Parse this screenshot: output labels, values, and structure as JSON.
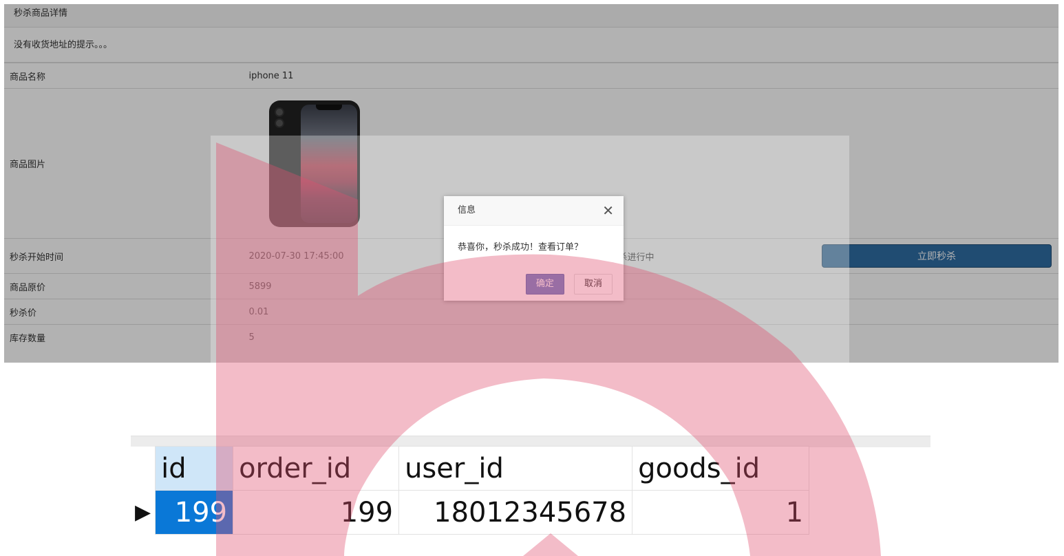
{
  "page": {
    "panel_title": "秒杀商品详情",
    "notice": "没有收货地址的提示。。。",
    "rows": {
      "name_label": "商品名称",
      "name_value": "iphone 11",
      "image_label": "商品图片",
      "start_label": "秒杀开始时间",
      "start_value": "2020-07-30 17:45:00",
      "status": "秒杀进行中",
      "buy_button": "立即秒杀",
      "orig_price_label": "商品原价",
      "orig_price_value": "5899",
      "seckill_price_label": "秒杀价",
      "seckill_price_value": "0.01",
      "stock_label": "库存数量",
      "stock_value": "5"
    }
  },
  "dialog": {
    "title": "信息",
    "close_glyph": "✕",
    "message": "恭喜你，秒杀成功！查看订单？",
    "confirm": "确定",
    "cancel": "取消"
  },
  "grid": {
    "columns": [
      "id",
      "order_id",
      "user_id",
      "goods_id"
    ],
    "row": {
      "marker": "▶",
      "id": "199",
      "order_id": "199",
      "user_id": "18012345678",
      "goods_id": "1"
    }
  },
  "colors": {
    "buy_button": "#2e6da4",
    "confirm_button": "#6e82c6",
    "selected_cell": "#0a78d7",
    "watermark": "#e0506e"
  }
}
